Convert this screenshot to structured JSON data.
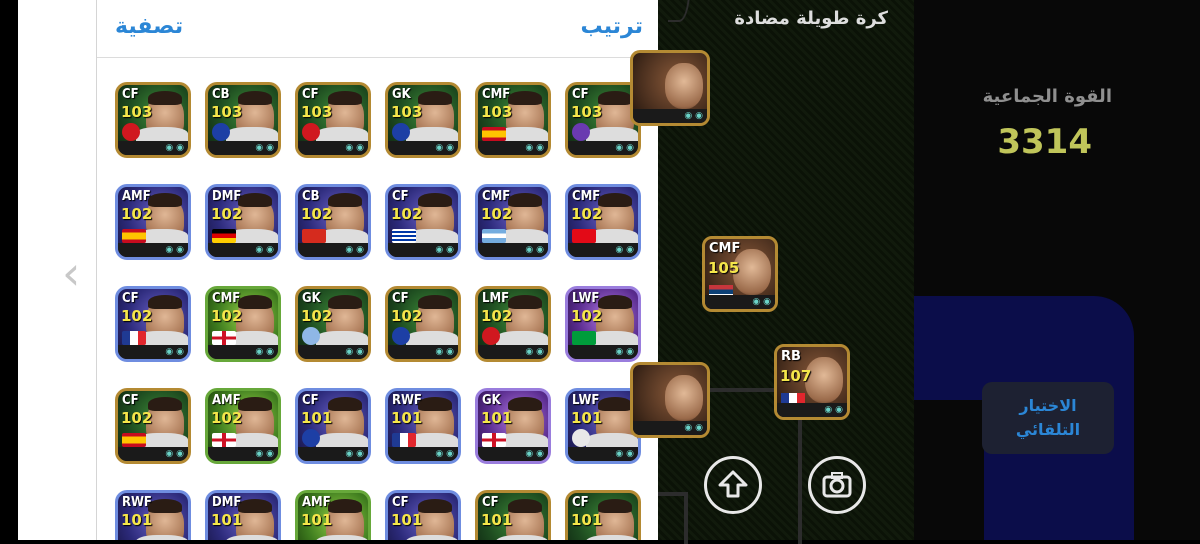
{
  "panel": {
    "filter_label": "تصفية",
    "sort_label": "ترتيب",
    "rows": [
      [
        {
          "pos": "CF",
          "rating": "103",
          "style": "gold",
          "emblem": "club-red",
          "flag": ""
        },
        {
          "pos": "CB",
          "rating": "103",
          "style": "gold",
          "emblem": "club-blue",
          "flag": ""
        },
        {
          "pos": "CF",
          "rating": "103",
          "style": "gold",
          "emblem": "club-red",
          "flag": ""
        },
        {
          "pos": "GK",
          "rating": "103",
          "style": "gold",
          "emblem": "club-blue",
          "flag": ""
        },
        {
          "pos": "CMF",
          "rating": "103",
          "style": "gold",
          "emblem": "",
          "flag": "spain"
        },
        {
          "pos": "CF",
          "rating": "103",
          "style": "gold",
          "emblem": "club-purple",
          "flag": ""
        }
      ],
      [
        {
          "pos": "AMF",
          "rating": "102",
          "style": "blue",
          "emblem": "",
          "flag": "spain"
        },
        {
          "pos": "DMF",
          "rating": "102",
          "style": "blue",
          "emblem": "",
          "flag": "germany"
        },
        {
          "pos": "CB",
          "rating": "102",
          "style": "blue",
          "emblem": "",
          "flag": "switzerland"
        },
        {
          "pos": "CF",
          "rating": "102",
          "style": "blue",
          "emblem": "",
          "flag": "uruguay"
        },
        {
          "pos": "CMF",
          "rating": "102",
          "style": "blue",
          "emblem": "",
          "flag": "argentina"
        },
        {
          "pos": "CMF",
          "rating": "102",
          "style": "blue",
          "emblem": "",
          "flag": "turkey"
        }
      ],
      [
        {
          "pos": "CF",
          "rating": "102",
          "style": "blue",
          "emblem": "",
          "flag": "france"
        },
        {
          "pos": "CMF",
          "rating": "102",
          "style": "green",
          "emblem": "",
          "flag": "england"
        },
        {
          "pos": "GK",
          "rating": "102",
          "style": "gold",
          "emblem": "club-sky",
          "flag": ""
        },
        {
          "pos": "CF",
          "rating": "102",
          "style": "gold",
          "emblem": "club-blue",
          "flag": ""
        },
        {
          "pos": "LMF",
          "rating": "102",
          "style": "gold",
          "emblem": "club-red",
          "flag": ""
        },
        {
          "pos": "LWF",
          "rating": "102",
          "style": "purple",
          "emblem": "",
          "flag": "brazil"
        }
      ],
      [
        {
          "pos": "CF",
          "rating": "102",
          "style": "gold",
          "emblem": "",
          "flag": "spain"
        },
        {
          "pos": "AMF",
          "rating": "102",
          "style": "green",
          "emblem": "",
          "flag": "england"
        },
        {
          "pos": "CF",
          "rating": "101",
          "style": "blue",
          "emblem": "club-blue",
          "flag": ""
        },
        {
          "pos": "RWF",
          "rating": "101",
          "style": "blue",
          "emblem": "",
          "flag": "france"
        },
        {
          "pos": "GK",
          "rating": "101",
          "style": "purple",
          "emblem": "",
          "flag": "england"
        },
        {
          "pos": "LWF",
          "rating": "101",
          "style": "blue",
          "emblem": "club-white",
          "flag": ""
        }
      ],
      [
        {
          "pos": "RWF",
          "rating": "101",
          "style": "blue",
          "emblem": "",
          "flag": ""
        },
        {
          "pos": "DMF",
          "rating": "101",
          "style": "blue",
          "emblem": "",
          "flag": ""
        },
        {
          "pos": "AMF",
          "rating": "101",
          "style": "green",
          "emblem": "",
          "flag": ""
        },
        {
          "pos": "CF",
          "rating": "101",
          "style": "blue",
          "emblem": "",
          "flag": ""
        },
        {
          "pos": "CF",
          "rating": "101",
          "style": "gold",
          "emblem": "",
          "flag": ""
        },
        {
          "pos": "CF",
          "rating": "101",
          "style": "gold",
          "emblem": "",
          "flag": ""
        }
      ]
    ]
  },
  "field": {
    "title": "كرة طويلة مضادة",
    "cards": [
      {
        "pos": "CMF",
        "rating": "105",
        "flag": "serbia"
      },
      {
        "pos": "RB",
        "rating": "107",
        "flag": "france"
      }
    ]
  },
  "side": {
    "power_label": "القوة الجماعية",
    "power_value": "3314",
    "auto_label_1": "الاختيار",
    "auto_label_2": "التلقائي"
  },
  "icons": {
    "back": "chevron-left-icon",
    "upload": "arrow-up-circle-icon",
    "camera": "camera-icon"
  },
  "colors": {
    "accent": "#2b86d6",
    "rating": "#f5e64a",
    "power": "#c0c55a"
  }
}
